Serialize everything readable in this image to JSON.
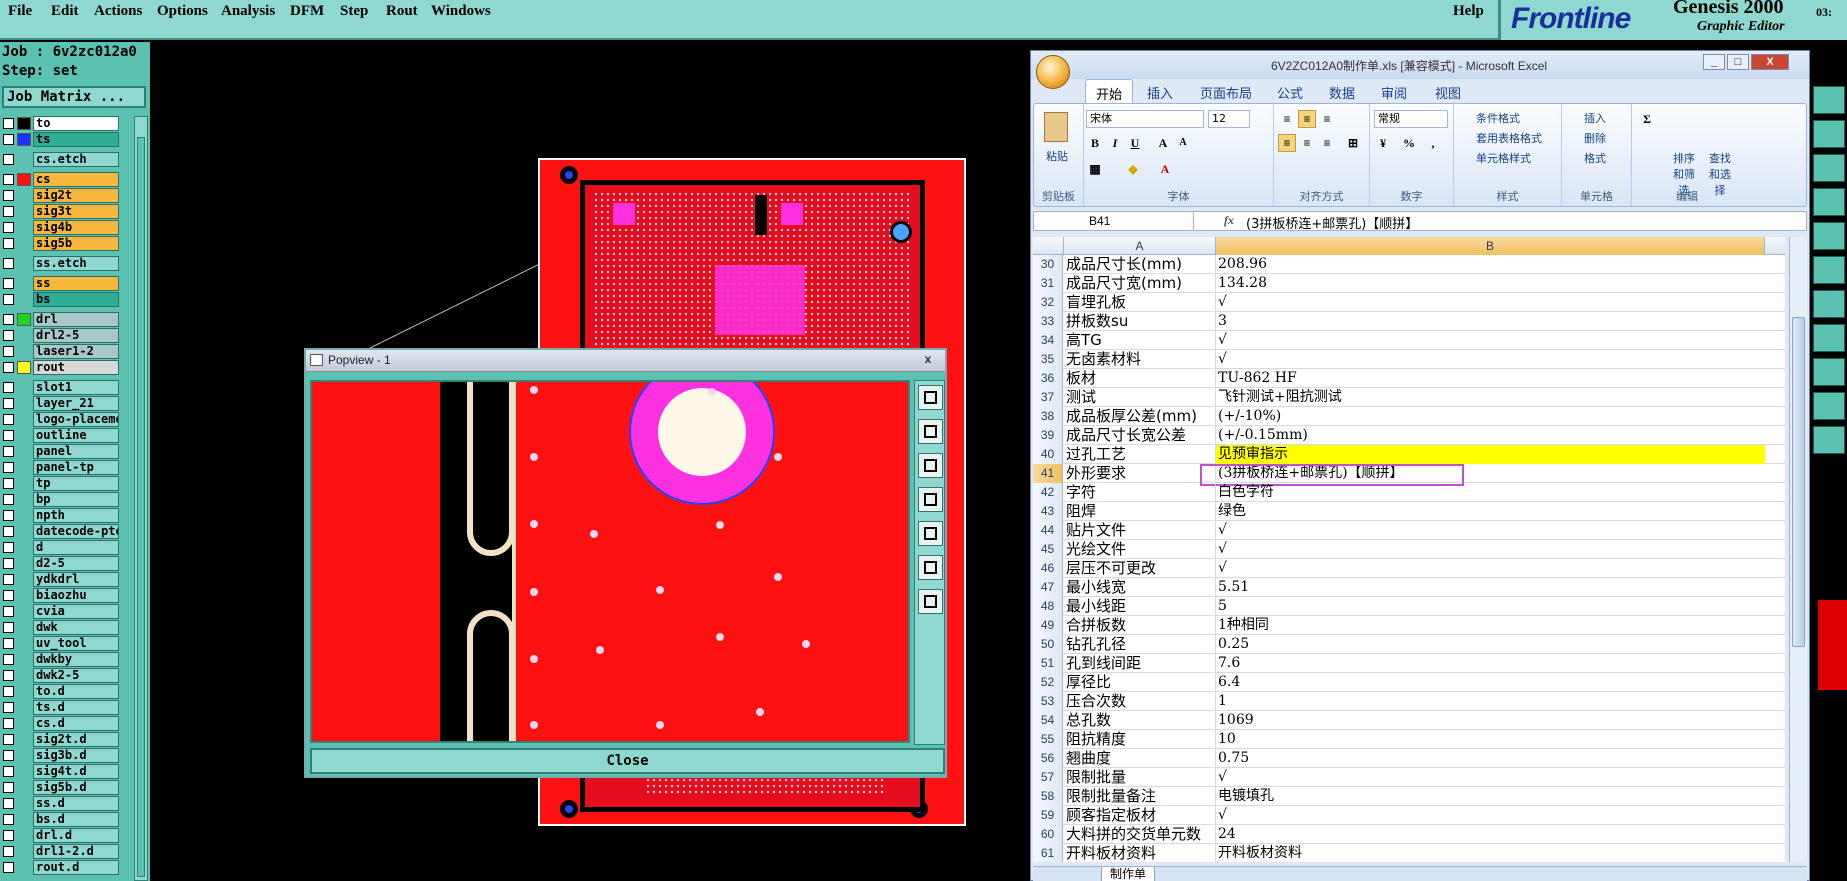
{
  "menubar": {
    "items": [
      "File",
      "Edit",
      "Actions",
      "Options",
      "Analysis",
      "DFM",
      "Step",
      "Rout",
      "Windows"
    ],
    "help": "Help"
  },
  "brand": {
    "logo": "Frontline",
    "product": "Genesis 2000",
    "subtitle": "Graphic Editor",
    "version": "03:"
  },
  "leftpanel": {
    "job": "Job : 6v2zc012a0",
    "step": "Step: set",
    "job_matrix": "Job Matrix ...",
    "layers": [
      {
        "name": "to",
        "color": "#000000",
        "bg": "#ffffff"
      },
      {
        "name": "ts",
        "color": "#1a33ff",
        "bg": "#2fae93"
      },
      {
        "name": "cs.etch",
        "color": "",
        "bg": "#8ed8cf"
      },
      {
        "name": "cs",
        "color": "#ff1111",
        "bg": "#f6b73c"
      },
      {
        "name": "sig2t",
        "color": "",
        "bg": "#f6b73c"
      },
      {
        "name": "sig3t",
        "color": "",
        "bg": "#f6b73c"
      },
      {
        "name": "sig4b",
        "color": "",
        "bg": "#f6b73c"
      },
      {
        "name": "sig5b",
        "color": "",
        "bg": "#f6b73c"
      },
      {
        "name": "ss.etch",
        "color": "",
        "bg": "#8ed8cf"
      },
      {
        "name": "ss",
        "color": "",
        "bg": "#f6b73c"
      },
      {
        "name": "bs",
        "color": "",
        "bg": "#2fae93"
      },
      {
        "name": "drl",
        "color": "#22d422",
        "bg": "#a8c8c8"
      },
      {
        "name": "drl2-5",
        "color": "",
        "bg": "#a8c8c8"
      },
      {
        "name": "laser1-2",
        "color": "",
        "bg": "#a8c8c8"
      },
      {
        "name": "rout",
        "color": "#ffff22",
        "bg": "#d8d8d8"
      },
      {
        "name": "slot1",
        "color": "",
        "bg": "#8ed8cf"
      },
      {
        "name": "layer_21",
        "color": "",
        "bg": "#8ed8cf"
      },
      {
        "name": "logo-placeme",
        "color": "",
        "bg": "#8ed8cf"
      },
      {
        "name": "outline",
        "color": "",
        "bg": "#8ed8cf"
      },
      {
        "name": "panel",
        "color": "",
        "bg": "#8ed8cf"
      },
      {
        "name": "panel-tp",
        "color": "",
        "bg": "#8ed8cf"
      },
      {
        "name": "tp",
        "color": "",
        "bg": "#8ed8cf"
      },
      {
        "name": "bp",
        "color": "",
        "bg": "#8ed8cf"
      },
      {
        "name": "npth",
        "color": "",
        "bg": "#8ed8cf"
      },
      {
        "name": "datecode-pte",
        "color": "",
        "bg": "#8ed8cf"
      },
      {
        "name": "d",
        "color": "",
        "bg": "#8ed8cf"
      },
      {
        "name": "d2-5",
        "color": "",
        "bg": "#8ed8cf"
      },
      {
        "name": "ydkdrl",
        "color": "",
        "bg": "#8ed8cf"
      },
      {
        "name": "biaozhu",
        "color": "",
        "bg": "#8ed8cf"
      },
      {
        "name": "cvia",
        "color": "",
        "bg": "#8ed8cf"
      },
      {
        "name": "dwk",
        "color": "",
        "bg": "#8ed8cf"
      },
      {
        "name": "uv_tool",
        "color": "",
        "bg": "#8ed8cf"
      },
      {
        "name": "dwkby",
        "color": "",
        "bg": "#8ed8cf"
      },
      {
        "name": "dwk2-5",
        "color": "",
        "bg": "#8ed8cf"
      },
      {
        "name": "to.d",
        "color": "",
        "bg": "#8ed8cf"
      },
      {
        "name": "ts.d",
        "color": "",
        "bg": "#8ed8cf"
      },
      {
        "name": "cs.d",
        "color": "",
        "bg": "#8ed8cf"
      },
      {
        "name": "sig2t.d",
        "color": "",
        "bg": "#8ed8cf"
      },
      {
        "name": "sig3b.d",
        "color": "",
        "bg": "#8ed8cf"
      },
      {
        "name": "sig4t.d",
        "color": "",
        "bg": "#8ed8cf"
      },
      {
        "name": "sig5b.d",
        "color": "",
        "bg": "#8ed8cf"
      },
      {
        "name": "ss.d",
        "color": "",
        "bg": "#8ed8cf"
      },
      {
        "name": "bs.d",
        "color": "",
        "bg": "#8ed8cf"
      },
      {
        "name": "drl.d",
        "color": "",
        "bg": "#8ed8cf"
      },
      {
        "name": "drl1-2.d",
        "color": "",
        "bg": "#8ed8cf"
      },
      {
        "name": "rout.d",
        "color": "",
        "bg": "#8ed8cf"
      }
    ]
  },
  "popview": {
    "title": "Popview - 1",
    "close_x": "x",
    "close_button": "Close"
  },
  "excel": {
    "title": "6V2ZC012A0制作单.xls  [兼容模式] - Microsoft Excel",
    "tabs": [
      "开始",
      "插入",
      "页面布局",
      "公式",
      "数据",
      "审阅",
      "视图"
    ],
    "ribbon": {
      "clipboard": {
        "paste": "粘贴",
        "label": "剪贴板"
      },
      "font": {
        "name": "宋体",
        "size": "12",
        "label": "字体"
      },
      "alignment": {
        "label": "对齐方式"
      },
      "number": {
        "format": "常规",
        "label": "数字"
      },
      "styles": {
        "conditional": "条件格式",
        "table": "套用表格格式",
        "cell": "单元格样式",
        "label": "样式"
      },
      "cells": {
        "insert": "插入",
        "delete": "删除",
        "format": "格式",
        "label": "单元格"
      },
      "editing": {
        "sort": "排序和筛选",
        "find": "查找和选择",
        "label": "编辑"
      }
    },
    "namebox": "B41",
    "fx": "fx",
    "formula": "(3拼板桥连+邮票孔)【顺拼】",
    "columns": [
      "A",
      "B"
    ],
    "rows": [
      {
        "n": "30",
        "a": "成品尺寸长(mm)",
        "b": "208.96"
      },
      {
        "n": "31",
        "a": "成品尺寸宽(mm)",
        "b": "134.28"
      },
      {
        "n": "32",
        "a": "盲埋孔板",
        "b": "√"
      },
      {
        "n": "33",
        "a": "拼板数su",
        "b": "3"
      },
      {
        "n": "34",
        "a": "高TG",
        "b": "√"
      },
      {
        "n": "35",
        "a": "无卤素材料",
        "b": "√"
      },
      {
        "n": "36",
        "a": "板材",
        "b": "TU-862 HF"
      },
      {
        "n": "37",
        "a": "测试",
        "b": "飞针测试+阻抗测试"
      },
      {
        "n": "38",
        "a": "成品板厚公差(mm)",
        "b": "(+/-10%)"
      },
      {
        "n": "39",
        "a": "成品尺寸长宽公差",
        "b": "(+/-0.15mm)"
      },
      {
        "n": "40",
        "a": "过孔工艺",
        "b": "见预审指示",
        "highlight": "#ffff00"
      },
      {
        "n": "41",
        "a": "外形要求",
        "b": "(3拼板桥连+邮票孔)【顺拼】",
        "selected": true
      },
      {
        "n": "42",
        "a": "字符",
        "b": "白色字符"
      },
      {
        "n": "43",
        "a": "阻焊",
        "b": "绿色"
      },
      {
        "n": "44",
        "a": "贴片文件",
        "b": "√"
      },
      {
        "n": "45",
        "a": "光绘文件",
        "b": "√"
      },
      {
        "n": "46",
        "a": "层压不可更改",
        "b": "√"
      },
      {
        "n": "47",
        "a": "最小线宽",
        "b": "5.51"
      },
      {
        "n": "48",
        "a": "最小线距",
        "b": "5"
      },
      {
        "n": "49",
        "a": "合拼板数",
        "b": "1种相同"
      },
      {
        "n": "50",
        "a": "钻孔孔径",
        "b": "0.25"
      },
      {
        "n": "51",
        "a": "孔到线间距",
        "b": "7.6"
      },
      {
        "n": "52",
        "a": "厚径比",
        "b": "6.4"
      },
      {
        "n": "53",
        "a": "压合次数",
        "b": "1"
      },
      {
        "n": "54",
        "a": "总孔数",
        "b": "1069"
      },
      {
        "n": "55",
        "a": "阻抗精度",
        "b": "10"
      },
      {
        "n": "56",
        "a": "翘曲度",
        "b": "0.75"
      },
      {
        "n": "57",
        "a": "限制批量",
        "b": "√"
      },
      {
        "n": "58",
        "a": "限制批量备注",
        "b": "电镀填孔"
      },
      {
        "n": "59",
        "a": "顾客指定板材",
        "b": "√"
      },
      {
        "n": "60",
        "a": "大料拼的交货单元数",
        "b": "24"
      },
      {
        "n": "61",
        "a": "开料板材资料",
        "b": "开料板材资料"
      }
    ],
    "sheet_tab": "制作单"
  }
}
